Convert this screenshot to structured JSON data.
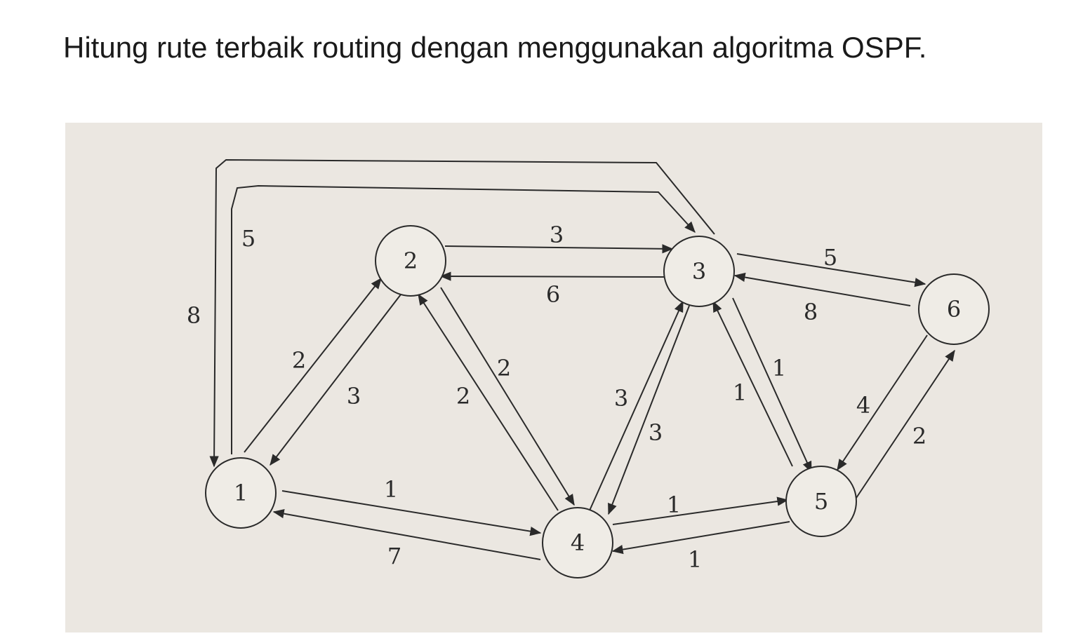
{
  "title": "Hitung rute terbaik routing dengan menggunakan algoritma OSPF.",
  "colors": {
    "paper": "#ebe7e1",
    "ink": "#2a2a2a",
    "page": "#ffffff"
  },
  "graph": {
    "nodes": [
      {
        "id": "1",
        "label": "1"
      },
      {
        "id": "2",
        "label": "2"
      },
      {
        "id": "3",
        "label": "3"
      },
      {
        "id": "4",
        "label": "4"
      },
      {
        "id": "5",
        "label": "5"
      },
      {
        "id": "6",
        "label": "6"
      }
    ],
    "edges": [
      {
        "from": "1",
        "to": "2",
        "weight": "2"
      },
      {
        "from": "2",
        "to": "1",
        "weight": "3"
      },
      {
        "from": "1",
        "to": "4",
        "weight": "1"
      },
      {
        "from": "4",
        "to": "1",
        "weight": "7"
      },
      {
        "from": "1",
        "to": "3",
        "weight": "5"
      },
      {
        "from": "3",
        "to": "1",
        "weight": "8"
      },
      {
        "from": "2",
        "to": "3",
        "weight": "3"
      },
      {
        "from": "3",
        "to": "2",
        "weight": "6"
      },
      {
        "from": "2",
        "to": "4",
        "weight": "2"
      },
      {
        "from": "4",
        "to": "2",
        "weight": "2"
      },
      {
        "from": "3",
        "to": "4",
        "weight": "3"
      },
      {
        "from": "4",
        "to": "3",
        "weight": "3"
      },
      {
        "from": "3",
        "to": "5",
        "weight": "1"
      },
      {
        "from": "5",
        "to": "3",
        "weight": "1"
      },
      {
        "from": "3",
        "to": "6",
        "weight": "5"
      },
      {
        "from": "6",
        "to": "3",
        "weight": "8"
      },
      {
        "from": "4",
        "to": "5",
        "weight": "1"
      },
      {
        "from": "5",
        "to": "4",
        "weight": "1"
      },
      {
        "from": "5",
        "to": "6",
        "weight": "2"
      },
      {
        "from": "6",
        "to": "5",
        "weight": "4"
      }
    ]
  }
}
